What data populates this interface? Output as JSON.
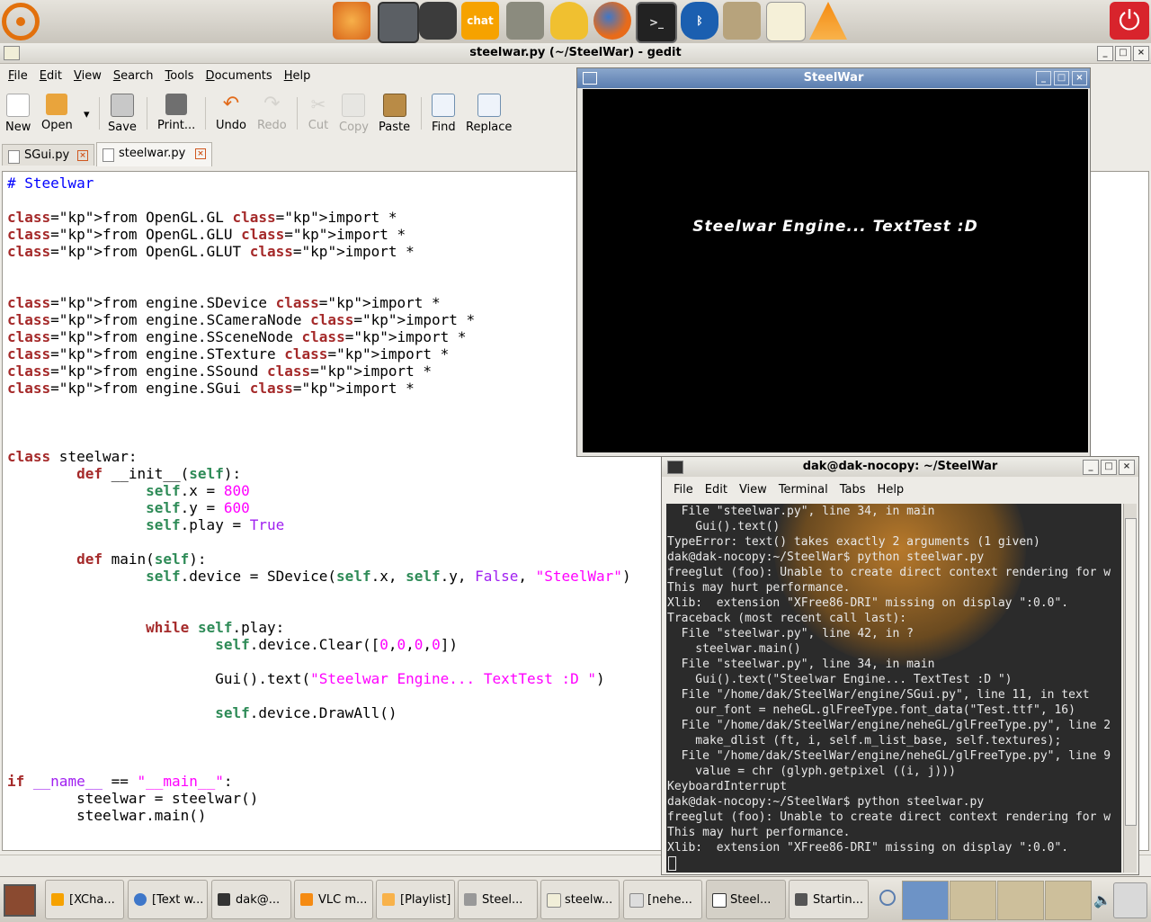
{
  "gedit": {
    "title": "steelwar.py (~/SteelWar) - gedit",
    "menu": [
      "File",
      "Edit",
      "View",
      "Search",
      "Tools",
      "Documents",
      "Help"
    ],
    "toolbar": {
      "new": "New",
      "open": "Open",
      "save": "Save",
      "print": "Print...",
      "undo": "Undo",
      "redo": "Redo",
      "cut": "Cut",
      "copy": "Copy",
      "paste": "Paste",
      "find": "Find",
      "replace": "Replace"
    },
    "tabs": [
      "SGui.py",
      "steelwar.py"
    ],
    "code": [
      "# Steelwar",
      "",
      "from OpenGL.GL import *",
      "from OpenGL.GLU import *",
      "from OpenGL.GLUT import *",
      "",
      "",
      "from engine.SDevice import *",
      "from engine.SCameraNode import *",
      "from engine.SSceneNode import *",
      "from engine.STexture import *",
      "from engine.SSound import *",
      "from engine.SGui import *",
      "",
      "",
      "",
      "class steelwar:",
      "        def __init__(self):",
      "                self.x = 800",
      "                self.y = 600",
      "                self.play = True",
      "",
      "        def main(self):",
      "                self.device = SDevice(self.x, self.y, False, \"SteelWar\")",
      "",
      "",
      "                while self.play:",
      "                        self.device.Clear([0,0,0,0])",
      "",
      "                        Gui().text(\"Steelwar Engine... TextTest :D \")",
      "",
      "                        self.device.DrawAll()",
      "",
      "",
      "",
      "if __name__ == \"__main__\":",
      "        steelwar = steelwar()",
      "        steelwar.main()"
    ]
  },
  "steelwar_window": {
    "title": "SteelWar",
    "gl_text": "Steelwar Engine... TextTest :D"
  },
  "terminal": {
    "title": "dak@dak-nocopy: ~/SteelWar",
    "menu": [
      "File",
      "Edit",
      "View",
      "Terminal",
      "Tabs",
      "Help"
    ],
    "lines": [
      "  File \"steelwar.py\", line 34, in main",
      "    Gui().text()",
      "TypeError: text() takes exactly 2 arguments (1 given)",
      "dak@dak-nocopy:~/SteelWar$ python steelwar.py",
      "freeglut (foo): Unable to create direct context rendering for w",
      "This may hurt performance.",
      "Xlib:  extension \"XFree86-DRI\" missing on display \":0.0\".",
      "Traceback (most recent call last):",
      "  File \"steelwar.py\", line 42, in ?",
      "    steelwar.main()",
      "  File \"steelwar.py\", line 34, in main",
      "    Gui().text(\"Steelwar Engine... TextTest :D \")",
      "  File \"/home/dak/SteelWar/engine/SGui.py\", line 11, in text",
      "    our_font = neheGL.glFreeType.font_data(\"Test.ttf\", 16)",
      "  File \"/home/dak/SteelWar/engine/neheGL/glFreeType.py\", line 2",
      "    make_dlist (ft, i, self.m_list_base, self.textures);",
      "  File \"/home/dak/SteelWar/engine/neheGL/glFreeType.py\", line 9",
      "    value = chr (glyph.getpixel ((i, j)))",
      "KeyboardInterrupt",
      "dak@dak-nocopy:~/SteelWar$ python steelwar.py",
      "freeglut (foo): Unable to create direct context rendering for w",
      "This may hurt performance.",
      "Xlib:  extension \"XFree86-DRI\" missing on display \":0.0\"."
    ]
  },
  "top_panel": {
    "launchers": [
      "blender-icon",
      "calculator-icon",
      "camera-icon",
      "xchat-icon",
      "gimp-icon",
      "messenger-icon",
      "firefox-icon",
      "terminal-icon",
      "bluetooth-icon",
      "rabbit-icon",
      "text-editor-icon",
      "vlc-icon"
    ],
    "chat_label": "chat",
    "power_icon": "power-icon"
  },
  "taskbar": {
    "items": [
      "[XCha...",
      "[Text w...",
      "dak@...",
      "VLC m...",
      "[Playlist]",
      "Steel...",
      "steelw...",
      "[nehe...",
      "Steel...",
      "Startin..."
    ]
  },
  "colors": {
    "keyword": "#a52a2a",
    "import_keyword": "#a020f0",
    "string": "#ff00ff",
    "self": "#2e8b57",
    "comment": "#0000ff",
    "titlebar_active": "#5a7daf",
    "power_button": "#d8242c"
  }
}
